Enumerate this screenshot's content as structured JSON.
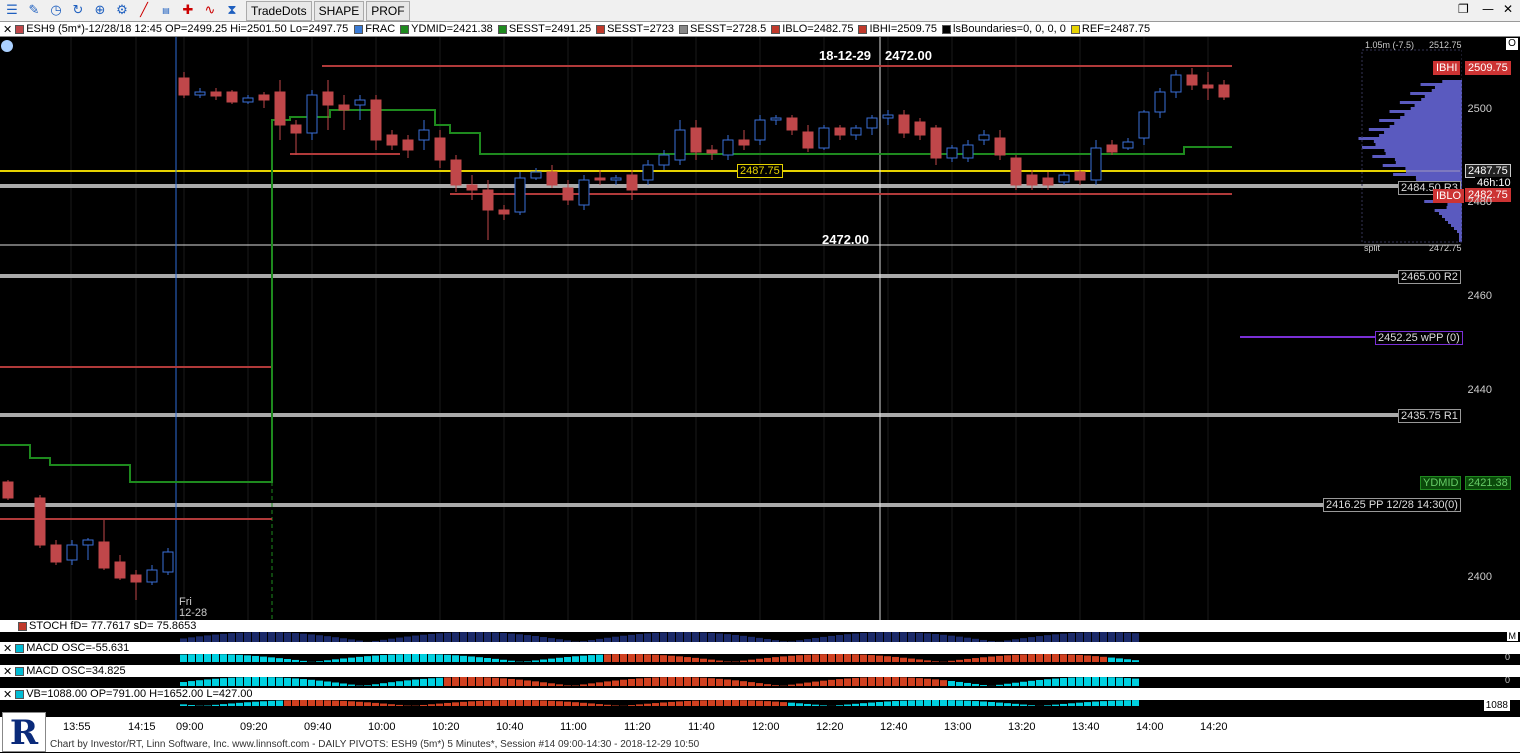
{
  "toolbar": {
    "icons": [
      "menu-icon",
      "pencil-icon",
      "clock-icon",
      "refresh-icon",
      "zoom-icon",
      "gear-icon",
      "line-tool-icon",
      "title-icon",
      "crosshair-icon",
      "wave-icon",
      "hourglass-icon"
    ],
    "buttons": [
      "TradeDots",
      "SHAPE",
      "PROF"
    ]
  },
  "legend": {
    "symbol": "ESH9 (5m*)-12/28/18 12:45 OP=2499.25 Hi=2501.50 Lo=2497.75",
    "items": [
      {
        "label": "FRAC",
        "color": "#3a7bd5"
      },
      {
        "label": "YDMID=2421.38",
        "color": "#1e8a1e"
      },
      {
        "label": "SESST=2491.25",
        "color": "#1e8a1e"
      },
      {
        "label": "SESST=2723",
        "color": "#c0392b"
      },
      {
        "label": "SESST=2728.5",
        "color": "#888888"
      },
      {
        "label": "IBLO=2482.75",
        "color": "#c0392b"
      },
      {
        "label": "IBHI=2509.75",
        "color": "#c0392b"
      },
      {
        "label": "lsBoundaries=0, 0, 0, 0",
        "color": "#000000"
      },
      {
        "label": "REF=2487.75",
        "color": "#e6d200"
      }
    ]
  },
  "price_axis": {
    "ticks": [
      "2500",
      "2480",
      "2460",
      "2440",
      "2400"
    ],
    "top_label": "1.05m (-7.5)",
    "top_value": "2512.75",
    "bottom_value": "2472.75",
    "split_label": "split"
  },
  "price_labels": {
    "ibhi_tag": "IBHI",
    "ibhi_value": "2509.75",
    "ref_value": "2487.75",
    "ref_marker": "2487.75",
    "time_remaining": "46h:10",
    "iblo_tag": "IBLO",
    "iblo_value": "2482.75",
    "r3": "2484.50 R3",
    "r2": "2465.00 R2",
    "wpp": "2452.25 wPP (0)",
    "r1": "2435.75 R1",
    "ydmid_tag": "YDMID",
    "ydmid_value": "2421.38",
    "pp": "2416.25 PP 12/28 14:30(0)"
  },
  "crosshair": {
    "date_label": "18-12-29",
    "price_top": "2472.00",
    "price_bottom": "2472.00"
  },
  "session_marker": {
    "day": "Fri",
    "date": "12-28"
  },
  "subpanels": [
    {
      "label": "STOCH fD= 77.7617 sD= 75.8653",
      "axis": "M",
      "color": "#c0392b"
    },
    {
      "label": "MACD OSC=-55.631",
      "axis": "0",
      "color": "#00bcd4"
    },
    {
      "label": "MACD OSC=34.825",
      "axis": "0",
      "color": "#00bcd4"
    },
    {
      "label": "VB=1088.00 OP=791.00 H=1652.00 L=427.00",
      "axis": "1088",
      "color": "#00bcd4"
    }
  ],
  "xaxis": {
    "ticks": [
      "13:55",
      "14:15",
      "09:00",
      "09:20",
      "09:40",
      "10:00",
      "10:20",
      "10:40",
      "11:00",
      "11:20",
      "11:40",
      "12:00",
      "12:20",
      "12:40",
      "13:00",
      "13:20",
      "13:40",
      "14:00",
      "14:20"
    ]
  },
  "footer": "Chart by Investor/RT, Linn Software, Inc. www.linnsoft.com - DAILY PIVOTS: ESH9 (5m*) 5 Minutes*, Session #14 09:00-14:30 - 2018-12-29 10:50",
  "colors": {
    "up": "#3a6fd8",
    "down": "#c0474a",
    "ref": "#e6d200",
    "pivot": "#aaaaaa",
    "sess": "#1e8a1e",
    "ib": "#b03a3a",
    "wpp": "#7a2fd6"
  }
}
